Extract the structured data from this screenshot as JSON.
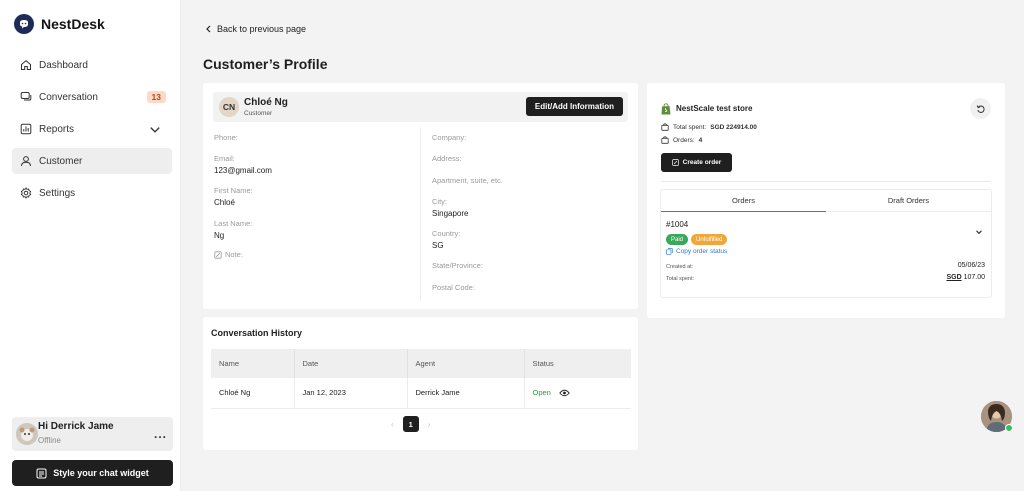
{
  "app": {
    "name": "NestDesk",
    "accent": "#1f1f1f"
  },
  "sidebar": {
    "items": [
      {
        "label": "Dashboard",
        "icon": "home-icon"
      },
      {
        "label": "Conversation",
        "icon": "chat-icon",
        "badge": "13"
      },
      {
        "label": "Reports",
        "icon": "chart-icon"
      },
      {
        "label": "Customer",
        "icon": "user-icon",
        "active": true
      },
      {
        "label": "Settings",
        "icon": "gear-icon"
      }
    ],
    "user": {
      "name": "Hi Derrick Jame",
      "status": "Offline",
      "more": "..."
    },
    "widget_button": "Style your chat widget"
  },
  "header": {
    "back": "Back to previous page",
    "title": "Customer’s Profile"
  },
  "profile": {
    "initials": "CN",
    "name": "Chloé Ng",
    "role": "Customer",
    "edit_button": "Edit/Add Information",
    "left_fields": {
      "phone_label": "Phone:",
      "email_label": "Email:",
      "email_value": "123@gmail.com",
      "first_name_label": "First Name:",
      "first_name_value": "Chloé",
      "last_name_label": "Last Name:",
      "last_name_value": "Ng",
      "note_label": "Note:"
    },
    "right_fields": {
      "company_label": "Company:",
      "address_label": "Address:",
      "apartment_label": "Apartment, suite, etc.",
      "city_label": "City:",
      "city_value": "Singapore",
      "country_label": "Country:",
      "country_value": "SG",
      "state_label": "State/Province:",
      "postal_label": "Postal Code:"
    }
  },
  "history": {
    "title": "Conversation History",
    "columns": [
      "Name",
      "Date",
      "Agent",
      "Status"
    ],
    "rows": [
      {
        "name": "Chloé Ng",
        "date": "Jan 12, 2023",
        "agent": "Derrick Jame",
        "status": "Open"
      }
    ],
    "pager": {
      "prev": "‹",
      "current": "1",
      "next": "›"
    }
  },
  "store": {
    "name": "NestScale test store",
    "total_spent_label": "Total spent:",
    "total_spent_value": "SGD 224914.00",
    "orders_label": "Orders:",
    "orders_value": "4",
    "create_button": "Create order",
    "tabs": [
      "Orders",
      "Draft Orders"
    ],
    "order": {
      "id": "#1004",
      "paid": "Paid",
      "fulfillment": "Unfulfilled",
      "copy_link": "Copy order status",
      "created_label": "Created at:",
      "created_value": "05/06/23",
      "total_label": "Total spent:",
      "total_currency": "SGD",
      "total_value": "107.00"
    }
  }
}
